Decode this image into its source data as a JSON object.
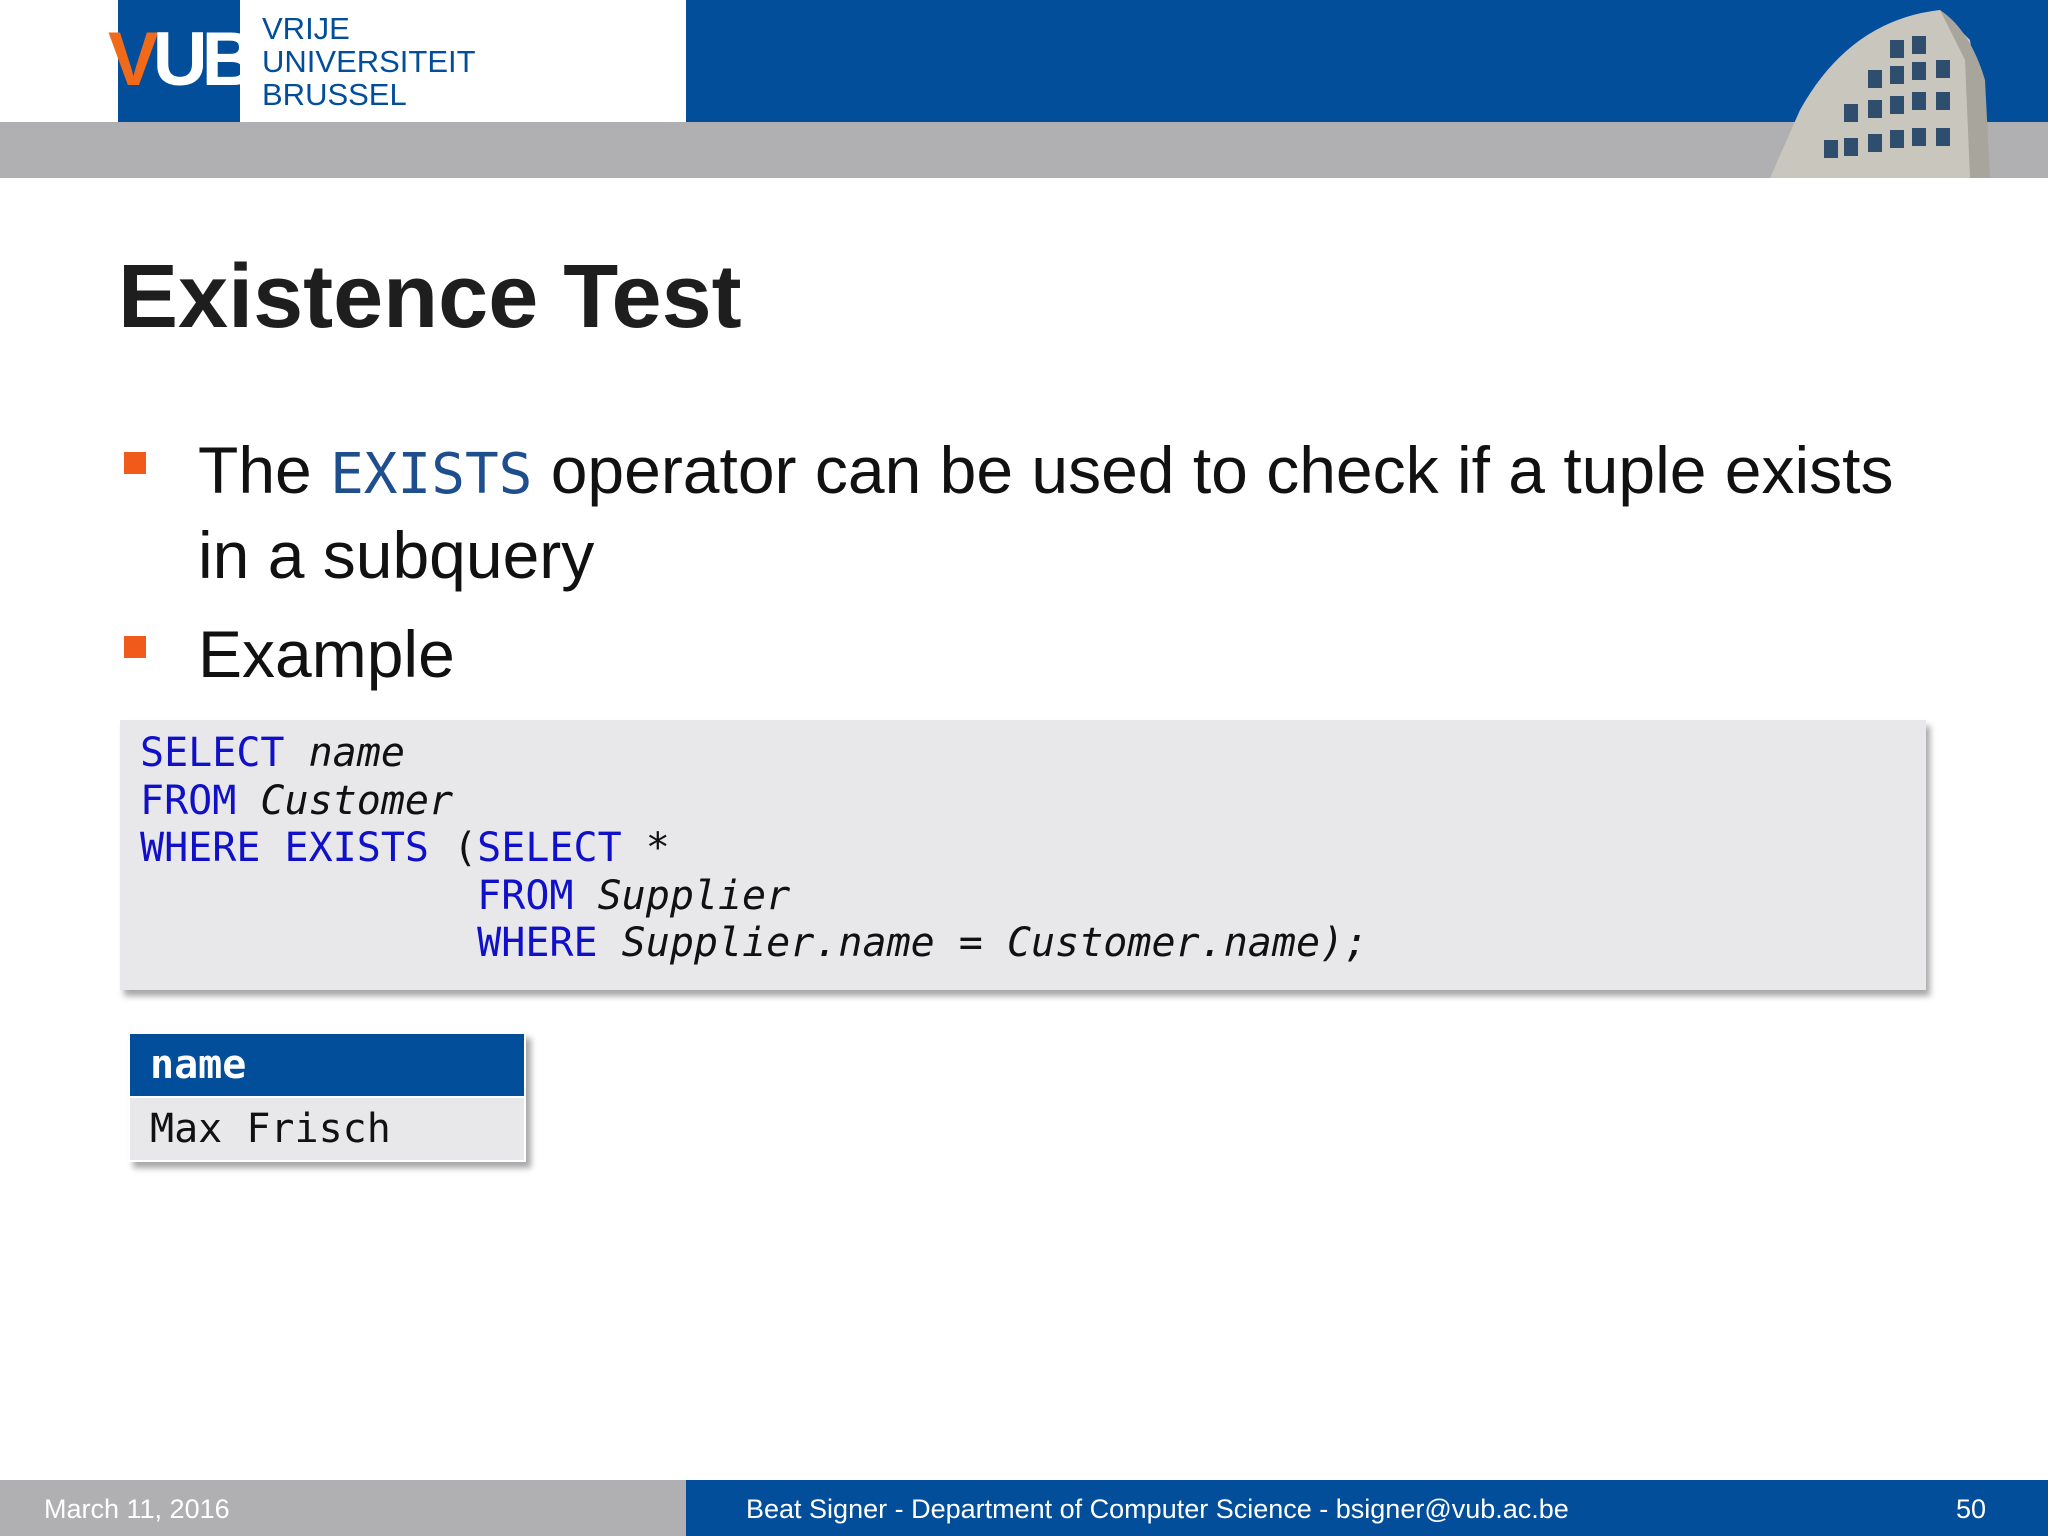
{
  "header": {
    "logo_letters_v": "V",
    "logo_letters_ub": "UB",
    "logo_line1": "VRIJE",
    "logo_line2": "UNIVERSITEIT",
    "logo_line3": "BRUSSEL"
  },
  "slide": {
    "title": "Existence Test",
    "bullets": [
      {
        "pre": "The ",
        "keyword": "EXISTS",
        "post": " operator can be used to check if a tuple exists in a subquery"
      },
      {
        "text": "Example"
      }
    ],
    "code_lines": [
      {
        "kw1": "SELECT",
        "rest": " name"
      },
      {
        "kw1": "FROM",
        "rest": " Customer"
      },
      {
        "kw1": "WHERE EXISTS",
        "p": " (",
        "kw2": "SELECT",
        "rest": " *"
      },
      {
        "indent": "              ",
        "kw1": "FROM",
        "rest": " Supplier"
      },
      {
        "indent": "              ",
        "kw1": "WHERE",
        "rest": " Supplier.name = Customer.name);"
      }
    ],
    "result_table": {
      "header": "name",
      "rows": [
        "Max Frisch"
      ]
    }
  },
  "footer": {
    "date": "March 11, 2016",
    "author": "Beat Signer - Department of Computer Science - bsigner@vub.ac.be",
    "page": "50"
  },
  "colors": {
    "brand_blue": "#034e9a",
    "accent_orange": "#f05a1a",
    "grey_band": "#b0afb1",
    "code_keyword": "#1010c8"
  }
}
